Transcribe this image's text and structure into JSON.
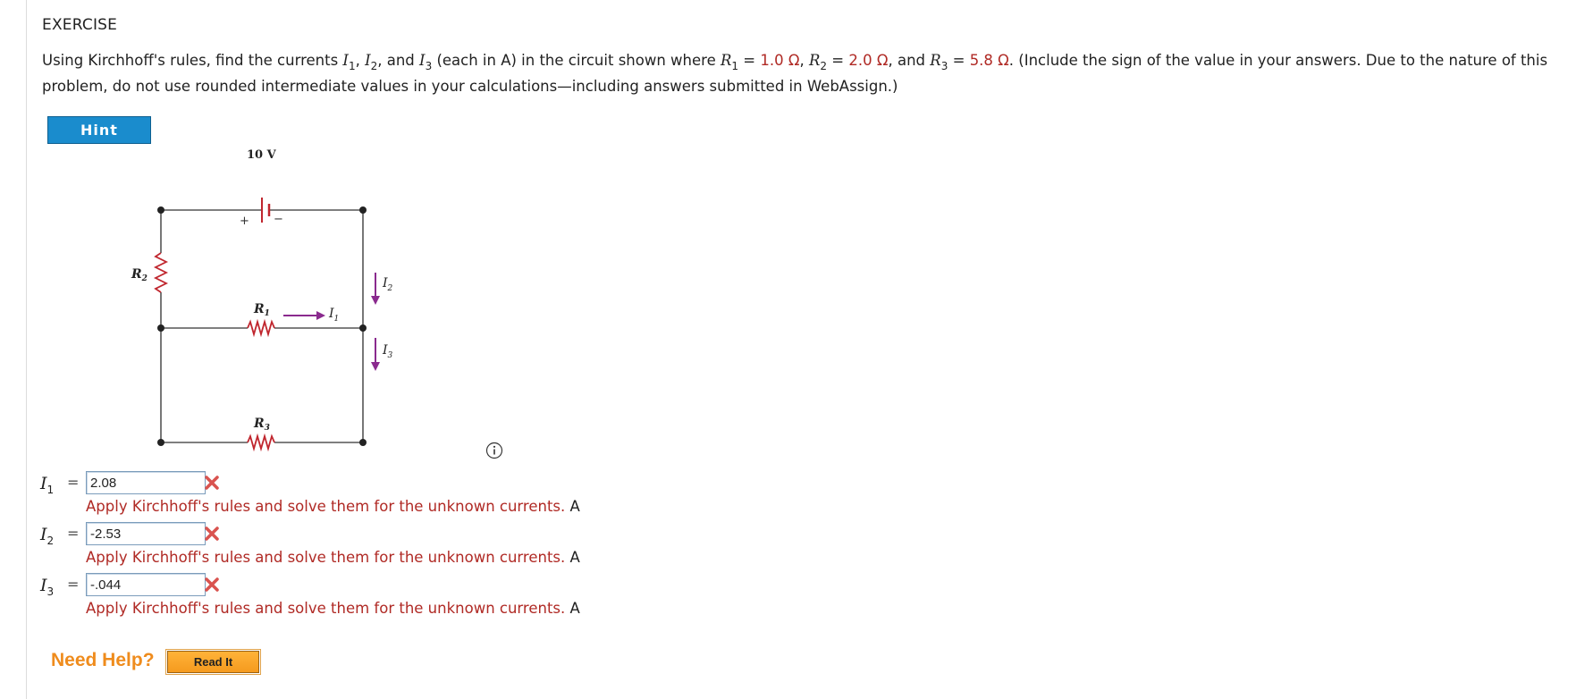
{
  "section": {
    "label": "EXERCISE"
  },
  "problem": {
    "p1": "Using Kirchhoff's rules, find the currents ",
    "i1_var": "I",
    "i1_sub": "1",
    "sep1": ", ",
    "i2_var": "I",
    "i2_sub": "2",
    "sep2": ", and ",
    "i3_var": "I",
    "i3_sub": "3",
    "p2": " (each in A) in the circuit shown where ",
    "r1_var": "R",
    "r1_sub": "1",
    "eq1": " = ",
    "r1_val": "1.0 Ω",
    "sep3": ", ",
    "r2_var": "R",
    "r2_sub": "2",
    "eq2": " = ",
    "r2_val": "2.0 Ω",
    "sep4": ", and ",
    "r3_var": "R",
    "r3_sub": "3",
    "eq3": " = ",
    "r3_val": "5.8 Ω",
    "p3": ". (Include the sign of the value in your answers. Due to the nature of this problem, do not use rounded intermediate values in your calculations—including answers submitted in WebAssign.)"
  },
  "hint": {
    "label": "Hint"
  },
  "diagram": {
    "battery_label": "10 V",
    "plus": "+",
    "minus": "−",
    "r1_var": "R",
    "r1_sub": "1",
    "r2_var": "R",
    "r2_sub": "2",
    "r3_var": "R",
    "r3_sub": "3",
    "i1_var": "I",
    "i1_sub": "1",
    "i2_var": "I",
    "i2_sub": "2",
    "i3_var": "I",
    "i3_sub": "3"
  },
  "answers": [
    {
      "var": "I",
      "sub": "1",
      "eq": "=",
      "value": "2.08",
      "feedback": "Apply Kirchhoff's rules and solve them for the unknown currents.",
      "unit": "A"
    },
    {
      "var": "I",
      "sub": "2",
      "eq": "=",
      "value": "-2.53",
      "feedback": "Apply Kirchhoff's rules and solve them for the unknown currents.",
      "unit": "A"
    },
    {
      "var": "I",
      "sub": "3",
      "eq": "=",
      "value": "-.044",
      "feedback": "Apply Kirchhoff's rules and solve them for the unknown currents.",
      "unit": "A"
    }
  ],
  "help": {
    "label": "Need Help?",
    "read_it": "Read It"
  },
  "colors": {
    "error": "#b02a25",
    "hint_bg": "#1a8ccd",
    "help_orange": "#ef8c1d",
    "arrow_purple": "#8a2a8e",
    "resistor_red": "#c0262e"
  },
  "icons": {
    "info": "info-icon",
    "wrong": "x-icon"
  }
}
